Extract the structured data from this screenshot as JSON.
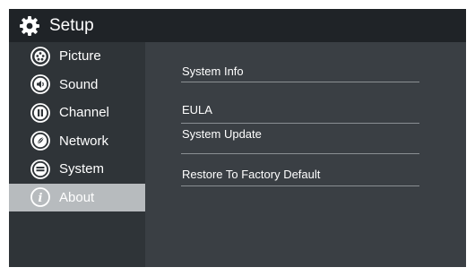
{
  "header": {
    "title": "Setup",
    "icon": "gear-icon"
  },
  "sidebar": {
    "items": [
      {
        "label": "Picture",
        "icon": "picture-icon"
      },
      {
        "label": "Sound",
        "icon": "sound-icon"
      },
      {
        "label": "Channel",
        "icon": "channel-icon"
      },
      {
        "label": "Network",
        "icon": "network-icon"
      },
      {
        "label": "System",
        "icon": "system-icon"
      },
      {
        "label": "About",
        "icon": "info-icon",
        "selected": true
      }
    ]
  },
  "content": {
    "items": [
      {
        "label": "System Info"
      },
      {
        "label": "EULA"
      },
      {
        "label": "System Update"
      },
      {
        "label": ""
      },
      {
        "label": "Restore To Factory Default"
      }
    ]
  },
  "colors": {
    "background": "#3a3f44",
    "header": "#1f2327",
    "sidebar": "#2f3438",
    "selected": "#b7bbbe",
    "divider": "#8a8f93"
  }
}
